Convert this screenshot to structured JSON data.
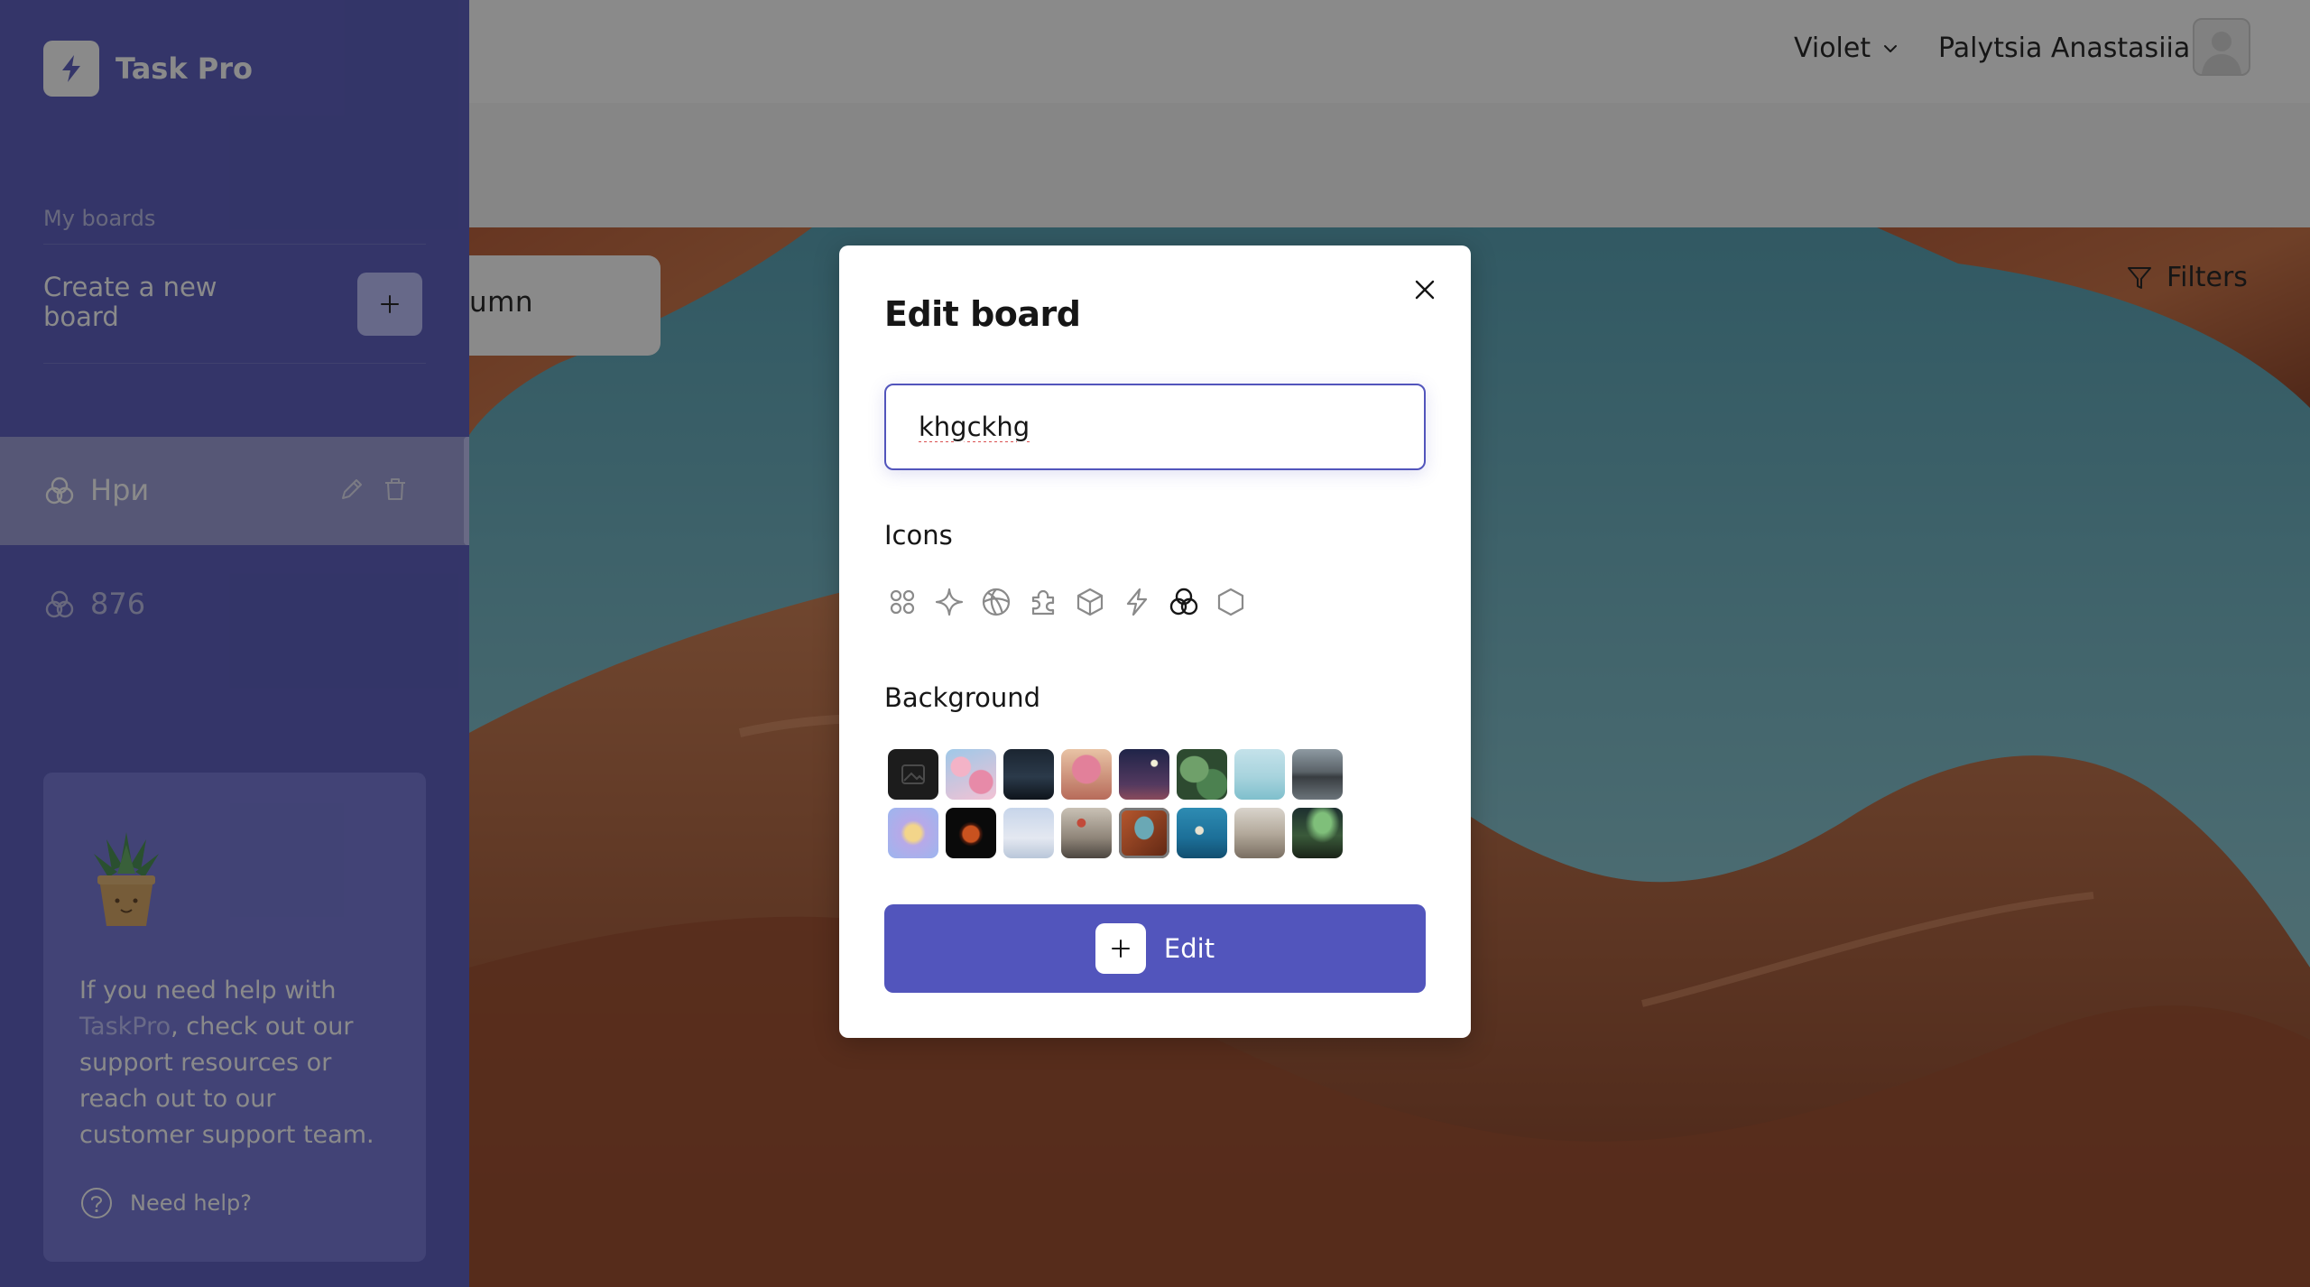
{
  "app": {
    "name": "Task Pro"
  },
  "header": {
    "theme": "Violet",
    "user_name": "Palytsia Anastasiia",
    "filters_label": "Filters"
  },
  "board": {
    "add_column_partial": "umn"
  },
  "sidebar": {
    "my_boards_label": "My boards",
    "create_board_label": "Create a new board",
    "boards": [
      {
        "label": "Нри",
        "icon": "colors-icon",
        "active": true
      },
      {
        "label": "876",
        "icon": "colors-icon",
        "active": false
      }
    ],
    "help": {
      "text_before": "If you need help with ",
      "brand": "TaskPro",
      "text_after": ", check out our support resources or reach out to our customer support team.",
      "need_help_label": "Need help?"
    }
  },
  "modal": {
    "title": "Edit board",
    "title_input_value": "khgckhg",
    "icons_label": "Icons",
    "icons": [
      "project-icon",
      "star-icon",
      "loading-icon",
      "puzzle-icon",
      "container-icon",
      "lightning-icon",
      "colors-icon",
      "hexagon-icon"
    ],
    "selected_icon": "colors-icon",
    "background_label": "Background",
    "backgrounds": [
      "no-background",
      "pink-blossom",
      "dark-mountain-night",
      "blossom-tree",
      "night-sky-moon",
      "green-leaves",
      "pale-sea",
      "lake-reflection",
      "purple-orb",
      "red-moon",
      "sailboat-sky",
      "hot-air-balloons",
      "canyon-arch",
      "tropical-sea",
      "balloon-valley",
      "aurora-night"
    ],
    "selected_background": "canyon-arch",
    "submit_label": "Edit"
  },
  "colors": {
    "accent": "#5255bc",
    "sidebar": "#5255bc",
    "overlay": "rgba(21,21,21,0.5)"
  }
}
